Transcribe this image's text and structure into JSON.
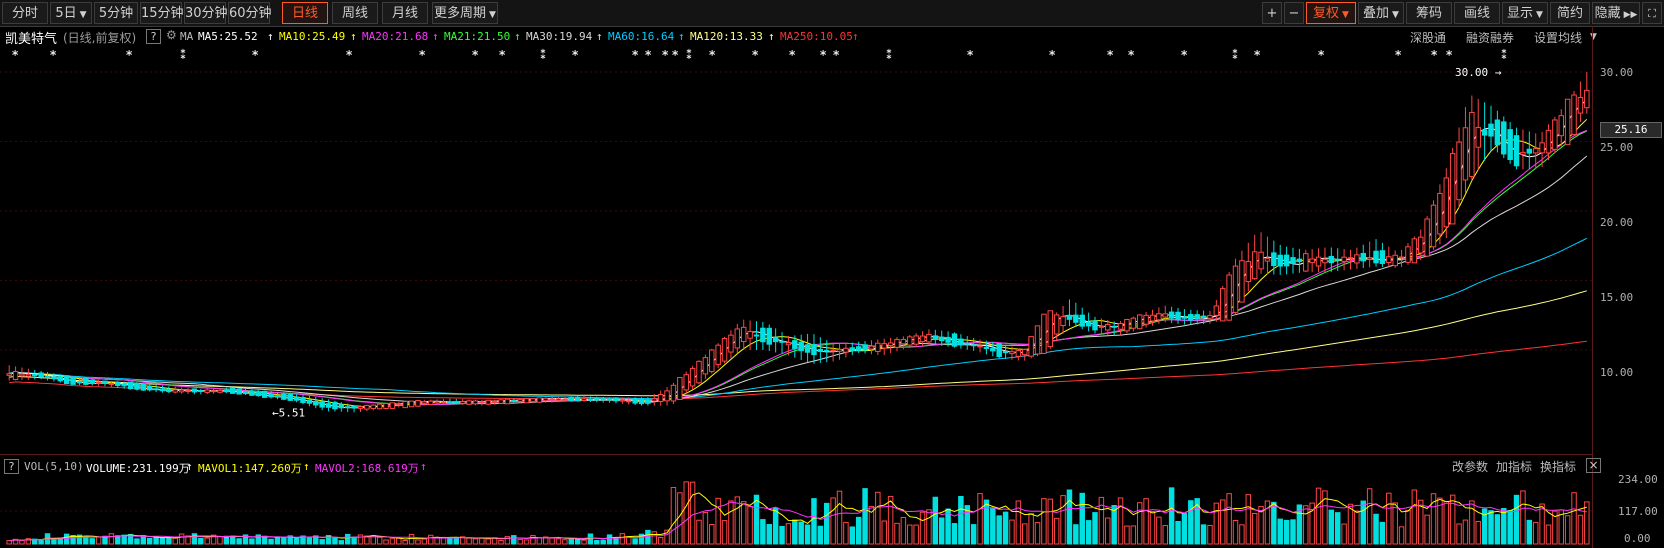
{
  "toolbar": {
    "periods": [
      "分时",
      "5日",
      "5分钟",
      "15分钟",
      "30分钟",
      "60分钟",
      "日线",
      "周线",
      "月线",
      "更多周期"
    ],
    "active_period": "日线",
    "right_buttons": [
      "复权",
      "叠加",
      "筹码",
      "画线",
      "显示",
      "简约",
      "隐藏"
    ],
    "zoom_in": "+",
    "zoom_out": "−",
    "fullscreen_icon": "fullscreen-icon"
  },
  "chart_header": {
    "stock_name": "凯美特气",
    "mode": "(日线,前复权)",
    "help": "?",
    "ma_label": "MA",
    "ma": [
      {
        "label": "MA5:25.52",
        "color": "#ffffff",
        "arrow": "↑"
      },
      {
        "label": "MA10:25.49",
        "color": "#ffff00",
        "arrow": "↑"
      },
      {
        "label": "MA20:21.68",
        "color": "#ff33ff",
        "arrow": "↑"
      },
      {
        "label": "MA21:21.50",
        "color": "#33ff33",
        "arrow": "↑"
      },
      {
        "label": "MA30:19.94",
        "color": "#d8d8d8",
        "arrow": "↑"
      },
      {
        "label": "MA60:16.64",
        "color": "#00ccff",
        "arrow": "↑"
      },
      {
        "label": "MA120:13.33",
        "color": "#ffff88",
        "arrow": "↑"
      },
      {
        "label": "MA250:10.05",
        "color": "#ff3333",
        "arrow": "↑"
      }
    ],
    "links": [
      "深股通",
      "融资融券",
      "设置均线"
    ]
  },
  "price_axis": {
    "ticks": [
      "30.00",
      "25.00",
      "20.00",
      "15.00",
      "10.00"
    ],
    "current": "25.16"
  },
  "annotations": {
    "high": "30.00",
    "low": "5.51"
  },
  "volume": {
    "help": "?",
    "title": "VOL(5,10)",
    "volume": "VOLUME:231.199万",
    "mavol1": "MAVOL1:147.260万",
    "mavol2": "MAVOL2:168.619万",
    "links": [
      "改参数",
      "加指标",
      "换指标"
    ],
    "close": "×",
    "ticks": [
      "234.00",
      "117.00",
      "0.00"
    ]
  },
  "chart_data": {
    "type": "candlestick",
    "title": "凯美特气",
    "price_ylim": [
      5,
      31
    ],
    "volume_ylim": [
      0,
      234
    ],
    "ohlc_sample": [
      [
        8.0,
        8.9,
        7.8,
        8.4
      ],
      [
        8.3,
        8.5,
        7.9,
        8.1
      ],
      [
        7.9,
        8.1,
        7.5,
        7.6
      ],
      [
        7.6,
        7.8,
        7.4,
        7.7
      ],
      [
        7.6,
        7.7,
        7.1,
        7.2
      ],
      [
        7.2,
        7.4,
        6.9,
        7.0
      ],
      [
        7.0,
        7.2,
        6.8,
        7.1
      ],
      [
        7.1,
        7.3,
        6.9,
        7.0
      ],
      [
        6.9,
        7.1,
        6.6,
        6.7
      ],
      [
        6.7,
        6.9,
        6.3,
        6.4
      ],
      [
        6.3,
        6.5,
        5.6,
        5.8
      ],
      [
        5.8,
        6.0,
        5.51,
        5.9
      ],
      [
        5.9,
        6.2,
        5.8,
        6.1
      ],
      [
        6.1,
        6.4,
        6.0,
        6.3
      ],
      [
        6.3,
        6.5,
        6.1,
        6.2
      ],
      [
        6.2,
        6.4,
        6.0,
        6.3
      ],
      [
        6.3,
        6.5,
        6.2,
        6.4
      ],
      [
        6.4,
        6.6,
        6.2,
        6.5
      ],
      [
        6.5,
        6.7,
        6.3,
        6.4
      ],
      [
        6.4,
        6.6,
        6.2,
        6.5
      ],
      [
        6.5,
        6.6,
        6.0,
        6.1
      ],
      [
        6.1,
        7.5,
        6.0,
        7.4
      ],
      [
        7.4,
        9.0,
        7.3,
        8.9
      ],
      [
        8.9,
        10.5,
        8.7,
        10.4
      ],
      [
        10.4,
        12.2,
        10.0,
        11.8
      ],
      [
        11.8,
        12.0,
        10.0,
        10.4
      ],
      [
        10.4,
        11.0,
        9.6,
        10.5
      ],
      [
        10.5,
        11.2,
        9.0,
        9.6
      ],
      [
        9.6,
        10.4,
        9.2,
        10.2
      ],
      [
        10.2,
        10.6,
        9.8,
        10.0
      ],
      [
        10.0,
        10.8,
        9.6,
        10.5
      ],
      [
        10.5,
        11.0,
        10.1,
        10.8
      ],
      [
        10.8,
        11.5,
        10.4,
        11.0
      ],
      [
        11.0,
        11.3,
        10.2,
        10.4
      ],
      [
        10.4,
        10.8,
        9.9,
        10.3
      ],
      [
        10.3,
        10.5,
        9.4,
        9.6
      ],
      [
        9.6,
        10.0,
        9.2,
        9.9
      ],
      [
        9.9,
        12.0,
        9.8,
        12.9
      ],
      [
        12.9,
        13.7,
        11.8,
        12.0
      ],
      [
        12.0,
        12.4,
        11.2,
        11.5
      ],
      [
        11.5,
        12.0,
        11.0,
        11.8
      ],
      [
        11.8,
        12.6,
        11.5,
        12.4
      ],
      [
        12.4,
        13.2,
        12.0,
        12.6
      ],
      [
        12.6,
        12.9,
        11.8,
        12.1
      ],
      [
        12.1,
        12.8,
        11.9,
        12.6
      ],
      [
        12.6,
        16.5,
        12.5,
        16.0
      ],
      [
        16.0,
        18.6,
        15.5,
        17.0
      ],
      [
        17.0,
        17.5,
        15.4,
        15.9
      ],
      [
        15.9,
        17.2,
        15.6,
        16.8
      ],
      [
        16.8,
        17.4,
        15.6,
        16.2
      ],
      [
        16.2,
        17.2,
        15.8,
        16.9
      ],
      [
        16.9,
        18.0,
        16.0,
        16.4
      ],
      [
        16.4,
        17.0,
        15.9,
        16.6
      ],
      [
        16.6,
        18.8,
        16.5,
        18.5
      ],
      [
        18.5,
        23.0,
        18.0,
        22.5
      ],
      [
        22.5,
        28.4,
        22.0,
        27.0
      ],
      [
        27.0,
        27.5,
        24.5,
        25.0
      ],
      [
        25.0,
        26.0,
        23.0,
        23.5
      ],
      [
        23.5,
        25.5,
        23.0,
        25.0
      ],
      [
        25.0,
        27.5,
        24.8,
        27.4
      ],
      [
        27.4,
        30.0,
        27.0,
        28.7
      ]
    ],
    "ma_latest": {
      "MA5": 25.52,
      "MA10": 25.49,
      "MA20": 21.68,
      "MA21": 21.5,
      "MA30": 19.94,
      "MA60": 16.64,
      "MA120": 13.33,
      "MA250": 10.05
    },
    "volume_latest": 231.199
  },
  "colors": {
    "up": "#ff4545",
    "down": "#00e0e0",
    "accent": "#ff5a2a"
  }
}
